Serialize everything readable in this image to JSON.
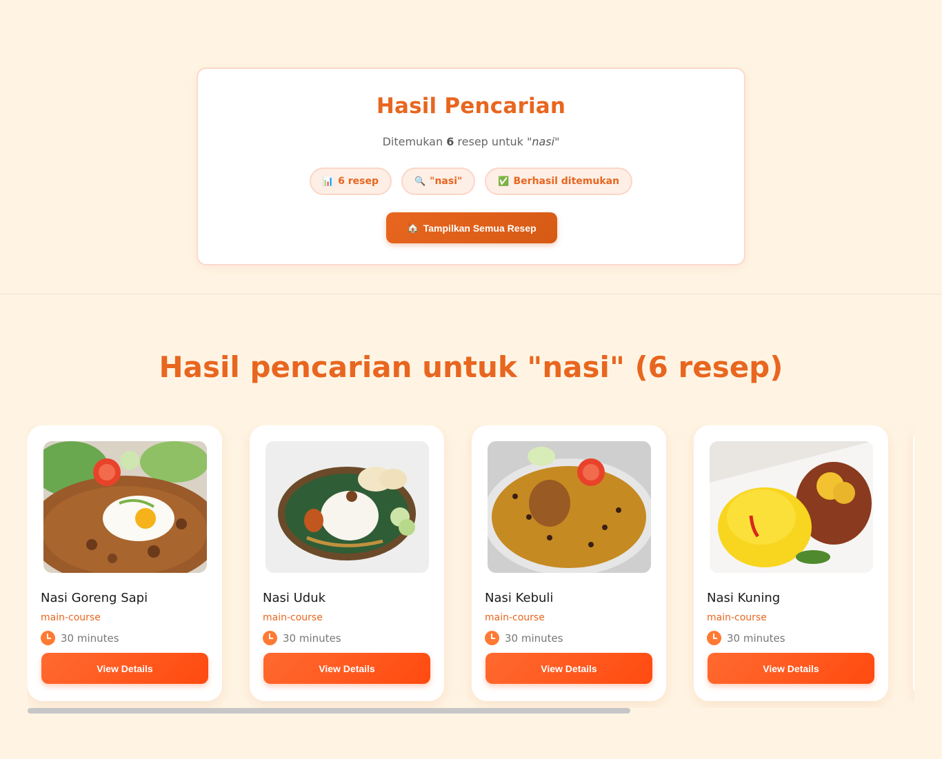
{
  "search_card": {
    "title": "Hasil Pencarian",
    "summary_prefix": "Ditemukan ",
    "summary_count": "6",
    "summary_middle": " resep untuk \"",
    "summary_query": "nasi",
    "summary_suffix": "\"",
    "chips": [
      {
        "icon": "📊",
        "label": "6 resep"
      },
      {
        "icon": "🔍",
        "label": "\"nasi\""
      },
      {
        "icon": "✅",
        "label": "Berhasil ditemukan"
      }
    ],
    "show_all_icon": "🏠",
    "show_all_label": "Tampilkan Semua Resep"
  },
  "results": {
    "heading": "Hasil pencarian untuk \"nasi\" (6 resep)",
    "cards": [
      {
        "title": "Nasi Goreng Sapi",
        "category": "main-course",
        "time": "30 minutes",
        "button": "View Details"
      },
      {
        "title": "Nasi Uduk",
        "category": "main-course",
        "time": "30 minutes",
        "button": "View Details"
      },
      {
        "title": "Nasi Kebuli",
        "category": "main-course",
        "time": "30 minutes",
        "button": "View Details"
      },
      {
        "title": "Nasi Kuning",
        "category": "main-course",
        "time": "30 minutes",
        "button": "View Details"
      }
    ]
  }
}
